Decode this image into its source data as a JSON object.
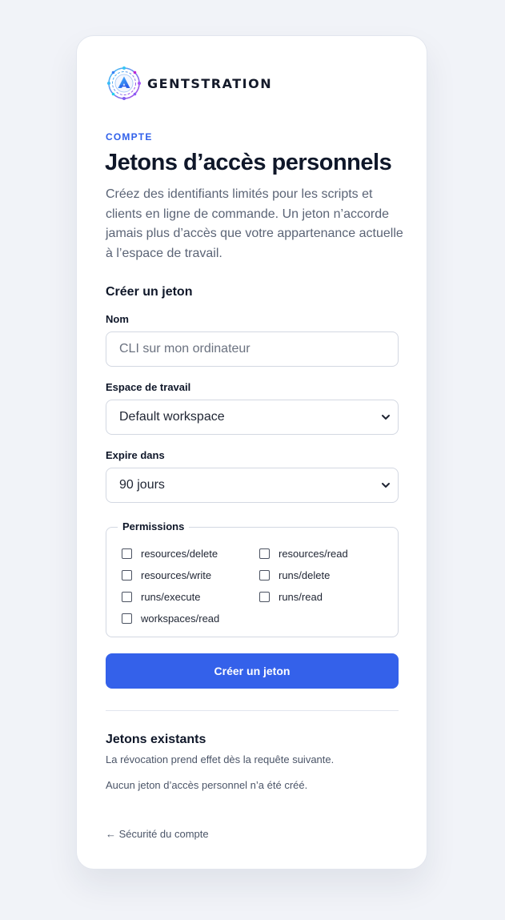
{
  "brand": {
    "name": "GENTSTRATION",
    "logo_icon": "gentstration-logo-icon"
  },
  "header": {
    "eyebrow": "COMPTE",
    "title": "Jetons d’accès personnels",
    "description": "Créez des identifiants limités pour les scripts et clients en ligne de commande. Un jeton n’accorde jamais plus d’accès que votre appartenance actuelle à l’espace de travail."
  },
  "create": {
    "heading": "Créer un jeton",
    "name_label": "Nom",
    "name_placeholder": "CLI sur mon ordinateur",
    "workspace_label": "Espace de travail",
    "workspace_value": "Default workspace",
    "expiry_label": "Expire dans",
    "expiry_value": "90 jours",
    "permissions_legend": "Permissions",
    "permissions": [
      {
        "label": "resources/delete",
        "checked": false
      },
      {
        "label": "resources/read",
        "checked": false
      },
      {
        "label": "resources/write",
        "checked": false
      },
      {
        "label": "runs/delete",
        "checked": false
      },
      {
        "label": "runs/execute",
        "checked": false
      },
      {
        "label": "runs/read",
        "checked": false
      },
      {
        "label": "workspaces/read",
        "checked": false
      }
    ],
    "submit_label": "Créer un jeton"
  },
  "existing": {
    "heading": "Jetons existants",
    "note": "La révocation prend effet dès la requête suivante.",
    "empty": "Aucun jeton d’accès personnel n’a été créé."
  },
  "back_link": "← Sécurité du compte",
  "colors": {
    "accent": "#3461ea",
    "background": "#f1f3f8",
    "text": "#0f1729",
    "muted": "#5b6476"
  }
}
